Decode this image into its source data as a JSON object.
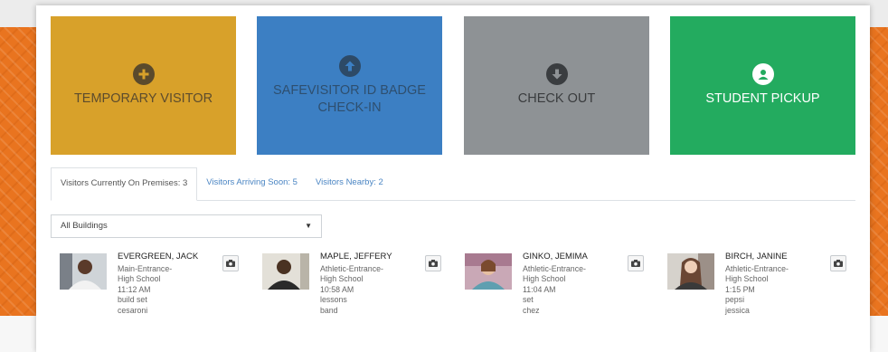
{
  "tiles": [
    {
      "label": "TEMPORARY VISITOR",
      "icon": "plus-circle-icon",
      "color": "#d8a12a"
    },
    {
      "label": "SAFEVISITOR ID BADGE CHECK-IN",
      "icon": "upload-circle-icon",
      "color": "#3c7fc3"
    },
    {
      "label": "CHECK OUT",
      "icon": "download-circle-icon",
      "color": "#8e9295"
    },
    {
      "label": "STUDENT PICKUP",
      "icon": "user-circle-icon",
      "color": "#23ab5f"
    }
  ],
  "tabs": [
    {
      "label": "Visitors Currently On Premises: 3",
      "active": true
    },
    {
      "label": "Visitors Arriving Soon: 5",
      "active": false
    },
    {
      "label": "Visitors Nearby: 2",
      "active": false
    }
  ],
  "building_filter": {
    "value": "All Buildings"
  },
  "visitors": [
    {
      "name": "EVERGREEN, JACK",
      "entrance": "Main-Entrance-",
      "school": "High School",
      "time": "11:12 AM",
      "reason": "build set",
      "host": "cesaroni"
    },
    {
      "name": "MAPLE, JEFFERY",
      "entrance": "Athletic-Entrance-",
      "school": "High School",
      "time": "10:58 AM",
      "reason": "lessons",
      "host": "band"
    },
    {
      "name": "GINKO, JEMIMA",
      "entrance": "Athletic-Entrance-",
      "school": "High School",
      "time": "11:04 AM",
      "reason": "set",
      "host": "chez"
    },
    {
      "name": "BIRCH, JANINE",
      "entrance": "Athletic-Entrance-",
      "school": "High School",
      "time": "1:15 PM",
      "reason": "pepsi",
      "host": "jessica"
    }
  ]
}
